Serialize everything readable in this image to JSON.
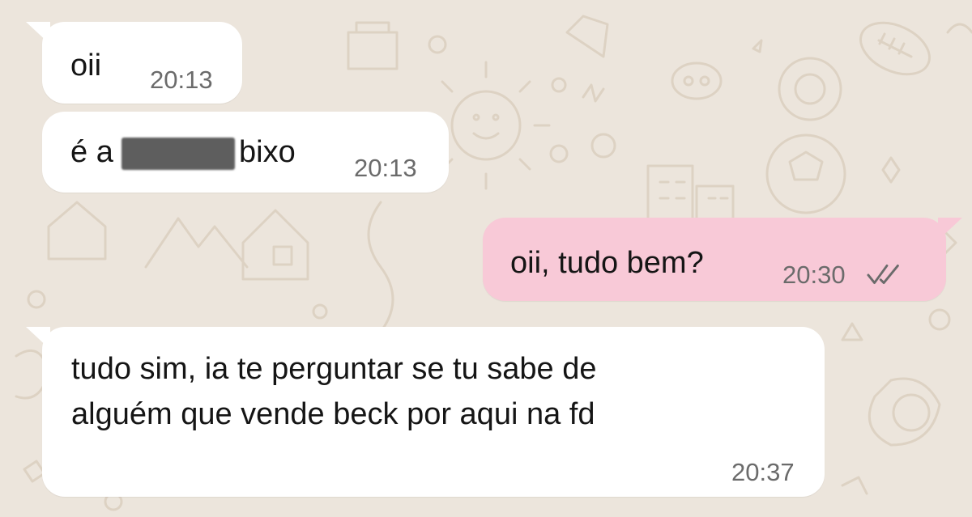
{
  "messages": [
    {
      "direction": "incoming",
      "text": "oii",
      "time": "20:13"
    },
    {
      "direction": "incoming",
      "text_before": "é a",
      "text_after": "bixo",
      "time": "20:13",
      "redacted": true
    },
    {
      "direction": "outgoing",
      "text": "oii, tudo bem?",
      "time": "20:30",
      "status": "read",
      "status_icon": "double-check-icon"
    },
    {
      "direction": "incoming",
      "lines": [
        "tudo sim, ia te perguntar se tu sabe de",
        "alguém que vende beck por aqui na fd"
      ],
      "time": "20:37"
    }
  ],
  "colors": {
    "background": "#ece5dc",
    "incoming_bubble": "#ffffff",
    "outgoing_bubble": "#f8c9d7",
    "timestamp": "#6b6b6b",
    "doodle": "#ddd2c3"
  }
}
